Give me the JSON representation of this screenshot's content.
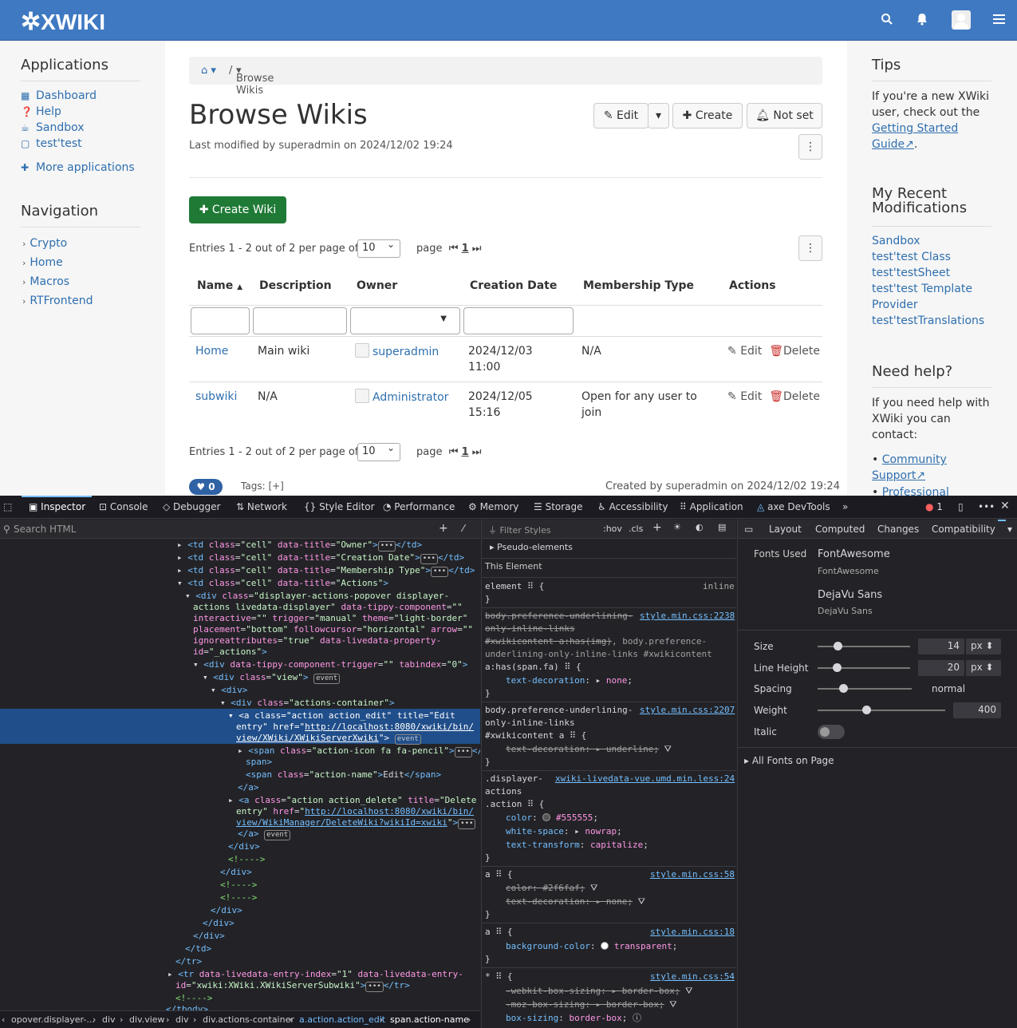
{
  "header": {
    "logo": "XWIKI",
    "search_icon": "search-icon",
    "bell_icon": "bell-icon",
    "menu_icon": "hamburger-icon"
  },
  "left": {
    "applications_title": "Applications",
    "apps": [
      "Dashboard",
      "Help",
      "Sandbox",
      "test'test"
    ],
    "more_apps": "More applications",
    "navigation_title": "Navigation",
    "nav": [
      "Crypto",
      "Home",
      "Macros",
      "RTFrontend"
    ]
  },
  "main": {
    "breadcrumb": "Browse Wikis",
    "title": "Browse Wikis",
    "last_modified": "Last modified by superadmin on 2024/12/02 19:24",
    "edit_label": "Edit",
    "create_label": "Create",
    "notset_label": "Not set",
    "create_wiki": "Create Wiki",
    "entries": "Entries 1 - 2 out of 2 per page of",
    "per_page": "10",
    "page_label": "page",
    "page_num": "1",
    "columns": [
      "Name",
      "Description",
      "Owner",
      "Creation Date",
      "Membership Type",
      "Actions"
    ],
    "rows": [
      {
        "name": "Home",
        "desc": "Main wiki",
        "owner": "superadmin",
        "date1": "2024/12/03",
        "date2": "11:00",
        "membership": "N/A",
        "membership2": "",
        "edit": "Edit",
        "delete": "Delete"
      },
      {
        "name": "subwiki",
        "desc": "N/A",
        "owner": "Administrator",
        "date1": "2024/12/05",
        "date2": "15:16",
        "membership": "Open for any user to",
        "membership2": "join",
        "edit": "Edit",
        "delete": "Delete"
      }
    ],
    "likes": "0",
    "tags": "Tags:",
    "tags_add": "[+]",
    "created": "Created by superadmin on 2024/12/02 19:24"
  },
  "right": {
    "tips_title": "Tips",
    "tips_1": "If you're a new XWiki",
    "tips_2": "user, check out the",
    "tips_link1": "Getting Started",
    "tips_link2": "Guide",
    "recent_title1": "My Recent",
    "recent_title2": "Modifications",
    "recent": [
      "Sandbox",
      "test'test Class",
      "test'testSheet",
      "test'test Template",
      "Provider",
      "test'testTranslations"
    ],
    "help_title": "Need help?",
    "help_1": "If you need help with",
    "help_2": "XWiki you can",
    "help_3": "contact:",
    "help_link1": "Community",
    "help_link1b": "Support",
    "help_link2": "Professional"
  },
  "devtools": {
    "tabs": [
      "Inspector",
      "Console",
      "Debugger",
      "Network",
      "Style Editor",
      "Performance",
      "Memory",
      "Storage",
      "Accessibility",
      "Application",
      "axe DevTools"
    ],
    "error_count": "1",
    "search_placeholder": "Search HTML",
    "filter_placeholder": "Filter Styles",
    "hov": ":hov",
    "cls": ".cls",
    "side_tabs": [
      "Layout",
      "Computed",
      "Changes",
      "Compatibility"
    ],
    "pseudo": "Pseudo-elements",
    "this_element": "This Element",
    "fonts_used": "Fonts Used",
    "font1": "FontAwesome",
    "font1b": "FontAwesome",
    "font2": "DejaVu Sans",
    "font2b": "DejaVu Sans",
    "size_label": "Size",
    "size_val": "14",
    "size_unit": "px",
    "lh_label": "Line Height",
    "lh_val": "20",
    "lh_unit": "px",
    "spacing_label": "Spacing",
    "spacing_val": "normal",
    "weight_label": "Weight",
    "weight_val": "400",
    "italic_label": "Italic",
    "all_fonts": "All Fonts on Page",
    "breadcrumbs": [
      "opover.displayer-...",
      "div",
      "div.view",
      "div",
      "div.actions-container",
      "a.action.action_edit",
      "span.action-name"
    ]
  }
}
